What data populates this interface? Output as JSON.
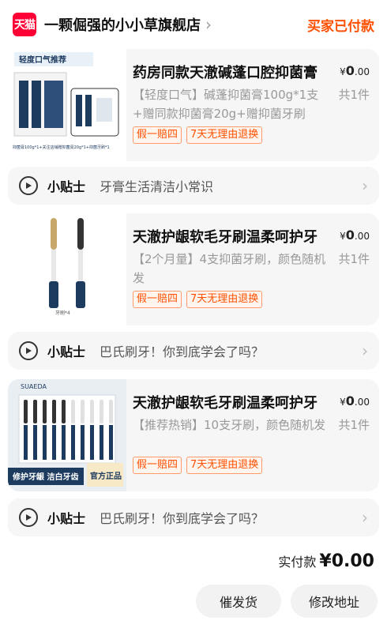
{
  "header": {
    "logo_text": "天猫",
    "store_name": "一颗倔强的小小草旗舰店",
    "status": "买家已付款"
  },
  "products": [
    {
      "title": "药房同款天澈碱蓬口腔抑菌膏",
      "price_symbol": "¥",
      "price_int": "0",
      "price_dec": ".00",
      "spec": "【轻度口气】碱蓬抑菌膏100g*1支+赠同款抑菌膏20g+赠抑菌牙刷",
      "qty": "共1件",
      "tags": [
        "假一赔四",
        "7天无理由退换"
      ],
      "thumb_banner": "轻度口气推荐",
      "thumb_caption": "抑菌膏100g*1+关注店铺赠抑菌膏20g*1+抑菌牙刷*1"
    },
    {
      "title": "天澈护龈软毛牙刷温柔呵护牙",
      "price_symbol": "¥",
      "price_int": "0",
      "price_dec": ".00",
      "spec": "【2个月量】4支抑菌牙刷，颜色随机发",
      "qty": "共1件",
      "tags": [
        "假一赔四",
        "7天无理由退换"
      ],
      "thumb_caption": "牙刷*4"
    },
    {
      "title": "天澈护龈软毛牙刷温柔呵护牙",
      "price_symbol": "¥",
      "price_int": "0",
      "price_dec": ".00",
      "spec": "【推荐热销】10支牙刷，颜色随机发",
      "qty": "共1件",
      "tags": [
        "假一赔四",
        "7天无理由退换"
      ],
      "thumb_brand": "SUAEDA",
      "thumb_caption": "修护牙龈 洁白牙齿",
      "thumb_badge": "官方正品"
    }
  ],
  "tips": [
    {
      "label": "小贴士",
      "text": "牙膏生活清洁小常识"
    },
    {
      "label": "小贴士",
      "text": "巴氏刷牙！你到底学会了吗？"
    },
    {
      "label": "小贴士",
      "text": "巴氏刷牙！你到底学会了吗？"
    }
  ],
  "summary": {
    "paid_label": "实付款",
    "paid_amount": "¥0.00"
  },
  "actions": {
    "urge_label": "催发货",
    "address_label": "修改地址"
  },
  "colors": {
    "accent": "#ff5000",
    "tmall_red": "#ff0036",
    "navy": "#1d3a5f"
  }
}
